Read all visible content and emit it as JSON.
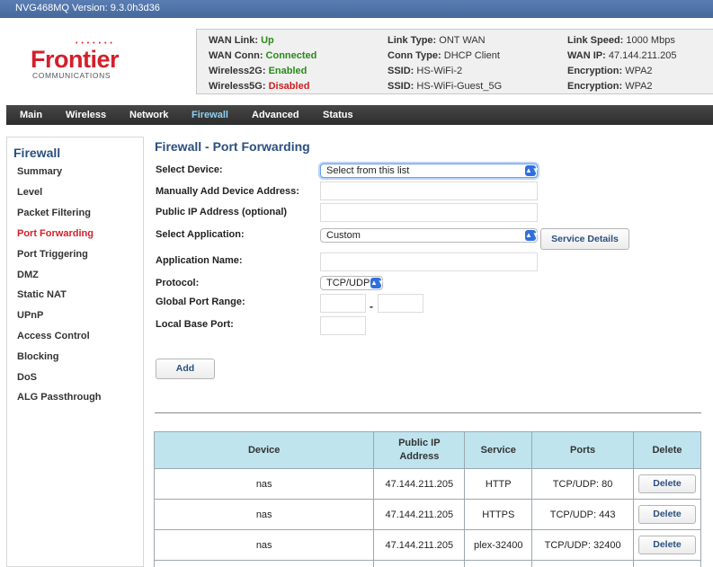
{
  "topbar": {
    "version_text": "NVG468MQ Version: 9.3.0h3d36"
  },
  "logo": {
    "dots": "• • • • • • •",
    "name": "Frontier",
    "sub": "COMMUNICATIONS"
  },
  "status": {
    "col1": [
      {
        "label": "WAN Link:",
        "value": "Up",
        "tone": "green"
      },
      {
        "label": "WAN Conn:",
        "value": "Connected",
        "tone": "green"
      },
      {
        "label": "Wireless2G:",
        "value": "Enabled",
        "tone": "green"
      },
      {
        "label": "Wireless5G:",
        "value": "Disabled",
        "tone": "red"
      }
    ],
    "col2": [
      {
        "label": "Link Type:",
        "value": "ONT WAN"
      },
      {
        "label": "Conn Type:",
        "value": "DHCP Client"
      },
      {
        "label": "SSID:",
        "value": "HS-WiFi-2"
      },
      {
        "label": "SSID:",
        "value": "HS-WiFi-Guest_5G"
      }
    ],
    "col3": [
      {
        "label": "Link Speed:",
        "value": "1000 Mbps"
      },
      {
        "label": "WAN IP:",
        "value": "47.144.211.205"
      },
      {
        "label": "Encryption:",
        "value": "WPA2"
      },
      {
        "label": "Encryption:",
        "value": "WPA2"
      }
    ]
  },
  "nav": [
    "Main",
    "Wireless",
    "Network",
    "Firewall",
    "Advanced",
    "Status"
  ],
  "nav_active": "Firewall",
  "sidebar": {
    "title": "Firewall",
    "items": [
      "Summary",
      "Level",
      "Packet Filtering",
      "Port Forwarding",
      "Port Triggering",
      "DMZ",
      "Static NAT",
      "UPnP",
      "Access Control",
      "Blocking",
      "DoS",
      "ALG Passthrough"
    ],
    "active": "Port Forwarding"
  },
  "main": {
    "title": "Firewall - Port Forwarding",
    "labels": {
      "select_device": "Select Device:",
      "manual_address": "Manually Add Device Address:",
      "public_ip": "Public IP Address (optional)",
      "select_application": "Select Application:",
      "application_name": "Application Name:",
      "protocol": "Protocol:",
      "global_port_range": "Global Port Range:",
      "local_base_port": "Local Base Port:"
    },
    "select_device_value": "Select from this list",
    "select_application_value": "Custom",
    "protocol_value": "TCP/UDP",
    "range_dash": "-",
    "service_details_button": "Service Details",
    "add_button": "Add"
  },
  "table": {
    "headers": [
      "Device",
      "Public IP Address",
      "Service",
      "Ports",
      "Delete"
    ],
    "rows": [
      {
        "device": "nas",
        "public_ip": "47.144.211.205",
        "service": "HTTP",
        "ports": "TCP/UDP: 80",
        "action": "Delete"
      },
      {
        "device": "nas",
        "public_ip": "47.144.211.205",
        "service": "HTTPS",
        "ports": "TCP/UDP: 443",
        "action": "Delete"
      },
      {
        "device": "nas",
        "public_ip": "47.144.211.205",
        "service": "plex-32400",
        "ports": "TCP/UDP: 32400",
        "action": "Delete"
      },
      {
        "device": "",
        "public_ip": "",
        "service": "",
        "ports": "",
        "action": ""
      }
    ]
  },
  "colors": {
    "brand_red": "#d3202a",
    "title_blue": "#2b4f7f",
    "nav_active": "#8fd0ee",
    "table_header": "#bfe4ee"
  }
}
